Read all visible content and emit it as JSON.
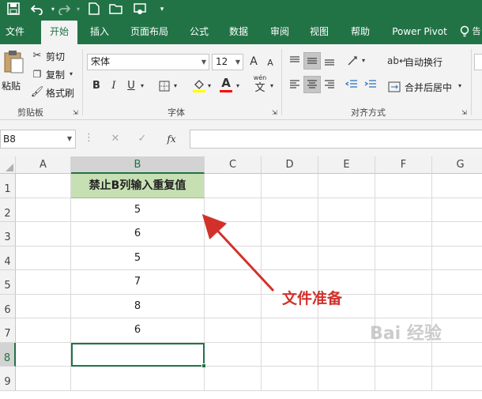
{
  "quick_access": {
    "icons": [
      "save-icon",
      "undo-icon",
      "redo-icon",
      "new-file-icon",
      "open-icon",
      "touch-mode-icon",
      "customize-icon"
    ]
  },
  "tabs": [
    "文件",
    "开始",
    "插入",
    "页面布局",
    "公式",
    "数据",
    "审阅",
    "视图",
    "帮助",
    "Power Pivot"
  ],
  "ribbon": {
    "clipboard": {
      "paste": "粘贴",
      "cut": "剪切",
      "copy": "复制",
      "format_painter": "格式刷",
      "label": "剪贴板"
    },
    "font": {
      "name": "宋体",
      "size": "12",
      "bold": "B",
      "italic": "I",
      "underline": "U",
      "font_color_glyph": "A",
      "phonetic": "wén",
      "phonetic_glyph": "文",
      "label": "字体",
      "grow": "A",
      "shrink": "A"
    },
    "alignment": {
      "wrap_text": "自动换行",
      "merge_center": "合并后居中",
      "label": "对齐方式"
    }
  },
  "formula_bar": {
    "name_box": "B8",
    "fx": "fx",
    "formula": ""
  },
  "sheet": {
    "columns": [
      "A",
      "B",
      "C",
      "D",
      "E",
      "F",
      "G"
    ],
    "rows": [
      "1",
      "2",
      "3",
      "4",
      "5",
      "6",
      "7",
      "8",
      "9"
    ],
    "b_values": [
      "禁止B列输入重复值",
      "5",
      "6",
      "5",
      "7",
      "8",
      "6",
      "",
      ""
    ],
    "header_fill": "#c6e0b4",
    "selected_cell": "B8"
  },
  "annotation": {
    "text": "文件准备",
    "color": "#d2312b"
  },
  "watermark": {
    "text": "Bai 经验"
  },
  "accent": "#217346"
}
